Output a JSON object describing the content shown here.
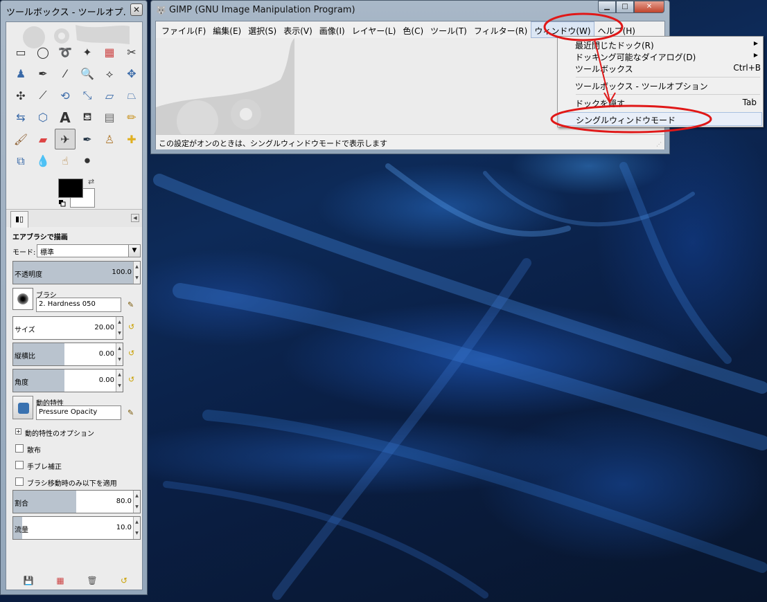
{
  "toolbox": {
    "title": "ツールボックス - ツールオプ...",
    "close_glyph": "✕",
    "options_tab_glyph": "▮▯",
    "options_menu_glyph": "◀",
    "tool_title": "エアブラシで描画",
    "mode_label": "モード:",
    "mode_value": "標準",
    "opacity_label": "不透明度",
    "opacity_value": "100.0",
    "opacity_fraction": 1.0,
    "brush_label": "ブラシ",
    "brush_value": "2. Hardness 050",
    "size_label": "サイズ",
    "size_value": "20.00",
    "aspect_label": "縦横比",
    "aspect_value": "0.00",
    "angle_label": "角度",
    "angle_value": "0.00",
    "dynamics_label": "動的特性",
    "dynamics_value": "Pressure Opacity",
    "dynamics_options_label": "動的特性のオプション",
    "scatter_label": "散布",
    "jitter_label": "手ブレ補正",
    "apply_on_move_label": "ブラシ移動時のみ以下を適用",
    "rate_label": "割合",
    "rate_value": "80.0",
    "flow_label": "流量",
    "flow_value": "10.0",
    "colors": {
      "fg": "#000000",
      "bg": "#ffffff"
    }
  },
  "gimp": {
    "title": "GIMP (GNU Image Manipulation Program)",
    "menus": [
      "ファイル(F)",
      "編集(E)",
      "選択(S)",
      "表示(V)",
      "画像(I)",
      "レイヤー(L)",
      "色(C)",
      "ツール(T)",
      "フィルター(R)",
      "ウィンドウ(W)",
      "ヘルプ(H)"
    ],
    "status_text": "この設定がオンのときは、シングルウィンドウモードで表示します"
  },
  "window_menu": {
    "recent_docks": "最近閉じたドック(R)",
    "dockable_dialogs": "ドッキング可能なダイアログ(D)",
    "toolbox": "ツールボックス",
    "toolbox_shortcut": "Ctrl+B",
    "toolbox_tool_options": "ツールボックス - ツールオプション",
    "hide_docks": "ドックを隠す",
    "hide_docks_shortcut": "Tab",
    "single_window_mode": "シングルウィンドウモード"
  },
  "accent_colors": {
    "annotation_red": "#e01818",
    "title_bar": "#a9b8c8"
  }
}
